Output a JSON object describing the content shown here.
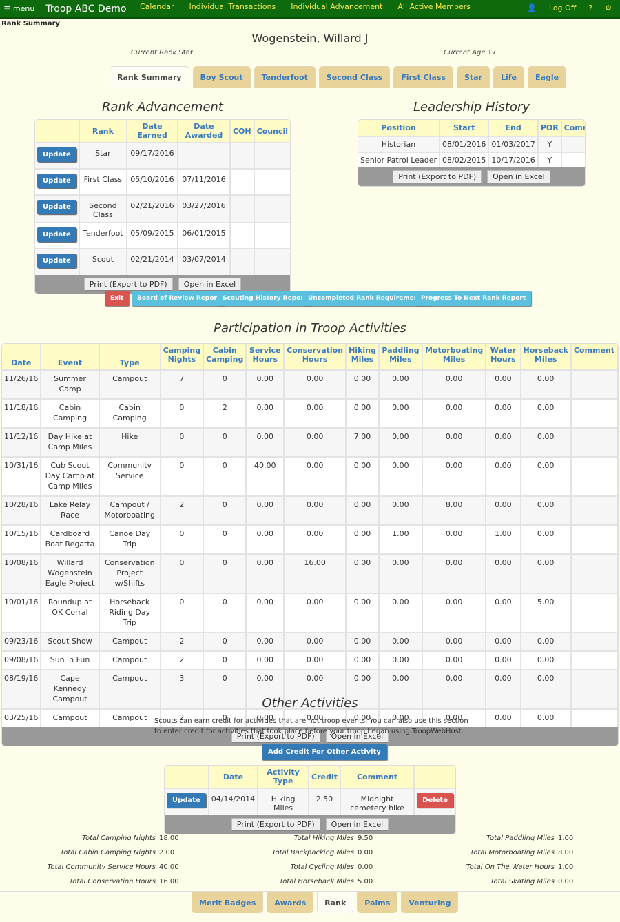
{
  "nav": {
    "menu": "menu",
    "brand": "Troop ABC Demo",
    "links": [
      "Calendar",
      "Individual Transactions",
      "Individual Advancement",
      "All Active Members"
    ],
    "logoff": "Log Off",
    "help": "?"
  },
  "breadcrumb": "Rank Summary",
  "scout": {
    "name": "Wogenstein, Willard J",
    "current_rank_label": "Current Rank",
    "current_rank": "Star",
    "current_age_label": "Current Age",
    "current_age": "17"
  },
  "top_tabs": [
    "Rank Summary",
    "Boy Scout",
    "Tenderfoot",
    "Second Class",
    "First Class",
    "Star",
    "Life",
    "Eagle"
  ],
  "rank_adv": {
    "title": "Rank Advancement",
    "headers": [
      "",
      "Rank",
      "Date Earned",
      "Date Awarded",
      "COH",
      "Council"
    ],
    "update_label": "Update",
    "rows": [
      [
        "Star",
        "09/17/2016",
        "",
        "",
        ""
      ],
      [
        "First Class",
        "05/10/2016",
        "07/11/2016",
        "",
        ""
      ],
      [
        "Second Class",
        "02/21/2016",
        "03/27/2016",
        "",
        ""
      ],
      [
        "Tenderfoot",
        "05/09/2015",
        "06/01/2015",
        "",
        ""
      ],
      [
        "Scout",
        "02/21/2014",
        "03/07/2014",
        "",
        ""
      ]
    ]
  },
  "leadership": {
    "title": "Leadership History",
    "headers": [
      "Position",
      "Start",
      "End",
      "POR",
      "Comment"
    ],
    "rows": [
      [
        "Historian",
        "08/01/2016",
        "01/03/2017",
        "Y",
        ""
      ],
      [
        "Senior Patrol Leader",
        "08/02/2015",
        "10/17/2016",
        "Y",
        ""
      ]
    ]
  },
  "print_label": "Print (Export to PDF)",
  "excel_label": "Open in Excel",
  "actions": {
    "exit": "Exit",
    "bor": "Board of Review Report",
    "history": "Scouting History Report",
    "uncompleted": "Uncompleted Rank Requirements",
    "progress": "Progress To Next Rank Report"
  },
  "participation": {
    "title": "Participation in Troop Activities",
    "headers": [
      "Date",
      "Event",
      "Type",
      "Camping Nights",
      "Cabin Camping",
      "Service Hours",
      "Conservation Hours",
      "Hiking Miles",
      "Paddling Miles",
      "Motorboating Miles",
      "Water Hours",
      "Horseback Miles",
      "Comment"
    ],
    "rows": [
      [
        "11/26/16",
        "Summer Camp",
        "Campout",
        "7",
        "0",
        "0.00",
        "0.00",
        "0.00",
        "0.00",
        "0.00",
        "0.00",
        "0.00",
        ""
      ],
      [
        "11/18/16",
        "Cabin Camping",
        "Cabin Camping",
        "0",
        "2",
        "0.00",
        "0.00",
        "0.00",
        "0.00",
        "0.00",
        "0.00",
        "0.00",
        ""
      ],
      [
        "11/12/16",
        "Day Hike at Camp Miles",
        "Hike",
        "0",
        "0",
        "0.00",
        "0.00",
        "7.00",
        "0.00",
        "0.00",
        "0.00",
        "0.00",
        ""
      ],
      [
        "10/31/16",
        "Cub Scout Day Camp at Camp Miles",
        "Community Service",
        "0",
        "0",
        "40.00",
        "0.00",
        "0.00",
        "0.00",
        "0.00",
        "0.00",
        "0.00",
        ""
      ],
      [
        "10/28/16",
        "Lake Relay Race",
        "Campout / Motorboating",
        "2",
        "0",
        "0.00",
        "0.00",
        "0.00",
        "0.00",
        "8.00",
        "0.00",
        "0.00",
        ""
      ],
      [
        "10/15/16",
        "Cardboard Boat Regatta",
        "Canoe Day Trip",
        "0",
        "0",
        "0.00",
        "0.00",
        "0.00",
        "1.00",
        "0.00",
        "1.00",
        "0.00",
        ""
      ],
      [
        "10/08/16",
        "Willard Wogenstein Eagle Project",
        "Conservation Project w/Shifts",
        "0",
        "0",
        "0.00",
        "16.00",
        "0.00",
        "0.00",
        "0.00",
        "0.00",
        "0.00",
        ""
      ],
      [
        "10/01/16",
        "Roundup at OK Corral",
        "Horseback Riding Day Trip",
        "0",
        "0",
        "0.00",
        "0.00",
        "0.00",
        "0.00",
        "0.00",
        "0.00",
        "5.00",
        ""
      ],
      [
        "09/23/16",
        "Scout Show",
        "Campout",
        "2",
        "0",
        "0.00",
        "0.00",
        "0.00",
        "0.00",
        "0.00",
        "0.00",
        "0.00",
        ""
      ],
      [
        "09/08/16",
        "Sun 'n Fun",
        "Campout",
        "2",
        "0",
        "0.00",
        "0.00",
        "0.00",
        "0.00",
        "0.00",
        "0.00",
        "0.00",
        ""
      ],
      [
        "08/19/16",
        "Cape Kennedy Campout",
        "Campout",
        "3",
        "0",
        "0.00",
        "0.00",
        "0.00",
        "0.00",
        "0.00",
        "0.00",
        "0.00",
        ""
      ],
      [
        "03/25/16",
        "Campout",
        "Campout",
        "2",
        "0",
        "0.00",
        "0.00",
        "0.00",
        "0.00",
        "0.00",
        "0.00",
        "0.00",
        ""
      ]
    ]
  },
  "other": {
    "title": "Other Activities",
    "desc": "Scouts can earn credit for activities that are not troop events.   You can also use this section to enter credit for activities that took place before your troop began using TroopWebHost.",
    "add_label": "Add Credit For Other Activity",
    "headers": [
      "",
      "Date",
      "Activity Type",
      "Credit",
      "Comment",
      ""
    ],
    "update_label": "Update",
    "delete_label": "Delete",
    "rows": [
      [
        "04/14/2014",
        "Hiking Miles",
        "2.50",
        "Midnight cemetery hike"
      ]
    ]
  },
  "totals": [
    [
      [
        "Total Camping Nights",
        "18.00"
      ],
      [
        "Total Cabin Camping Nights",
        "2.00"
      ],
      [
        "Total Community Service Hours",
        "40.00"
      ],
      [
        "Total Conservation Hours",
        "16.00"
      ]
    ],
    [
      [
        "Total Hiking Miles",
        "9.50"
      ],
      [
        "Total Backpacking Miles",
        "0.00"
      ],
      [
        "Total Cycling Miles",
        "0.00"
      ],
      [
        "Total Horseback Miles",
        "5.00"
      ]
    ],
    [
      [
        "Total Paddling Miles",
        "1.00"
      ],
      [
        "Total Motorboating Miles",
        "8.00"
      ],
      [
        "Total On The Water Hours",
        "1.00"
      ],
      [
        "Total Skating Miles",
        "0.00"
      ]
    ]
  ],
  "bottom_tabs": [
    "Merit Badges",
    "Awards",
    "Rank",
    "Palms",
    "Venturing"
  ],
  "colors": {
    "nav": "#0d6b0d",
    "link": "#f3e94a",
    "header_bg": "#fefcc4",
    "header_text": "#3a7abf",
    "tab_bg": "#e8d49a",
    "primary": "#337ab7",
    "info": "#5bc0de",
    "danger": "#d9534f"
  }
}
